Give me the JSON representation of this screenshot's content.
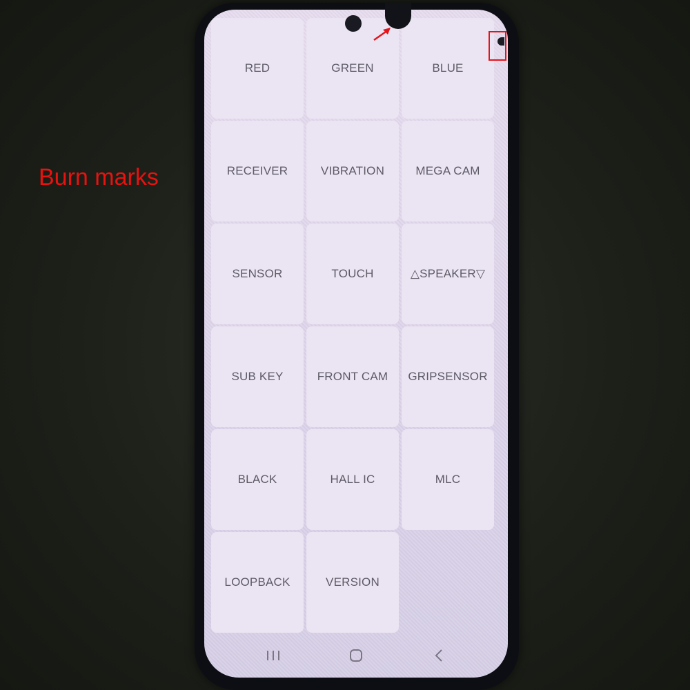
{
  "annotation": {
    "text": "Burn marks",
    "color": "#e8120f"
  },
  "test_menu": {
    "tiles": [
      {
        "label": "RED"
      },
      {
        "label": "GREEN"
      },
      {
        "label": "BLUE"
      },
      {
        "label": "RECEIVER"
      },
      {
        "label": "VIBRATION"
      },
      {
        "label": "MEGA CAM"
      },
      {
        "label": "SENSOR"
      },
      {
        "label": "TOUCH"
      },
      {
        "label": "△SPEAKER▽"
      },
      {
        "label": "SUB KEY"
      },
      {
        "label": "FRONT CAM"
      },
      {
        "label": "GRIPSENSOR"
      },
      {
        "label": "BLACK"
      },
      {
        "label": "HALL IC"
      },
      {
        "label": "MLC"
      },
      {
        "label": "LOOPBACK"
      },
      {
        "label": "VERSION"
      }
    ]
  },
  "navbar": {
    "recents": "recent-apps-icon",
    "home": "home-icon",
    "back": "back-icon"
  },
  "markers": {
    "highlight_color": "#e5141a"
  }
}
